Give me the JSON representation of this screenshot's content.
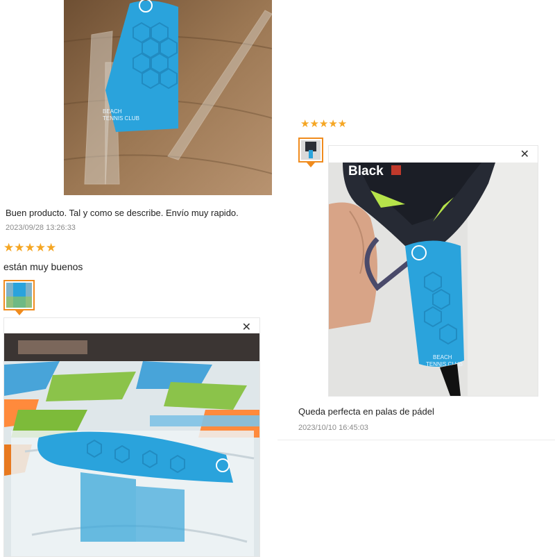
{
  "reviews": [
    {
      "text": "Buen producto. Tal y como se describe. Envío muy rapido.",
      "date": "2023/09/28 13:26:33"
    },
    {
      "stars": "★★★★★",
      "text": "están muy buenos",
      "close_label": "✕"
    },
    {
      "stars": "★★★★★",
      "text": "Queda perfecta en palas de pádel",
      "date": "2023/10/10 16:45:03",
      "close_label": "✕"
    }
  ],
  "photo_print": {
    "grip_logo": "e",
    "grip_text_line1": "BEACH",
    "grip_text_line2": "TENNIS CLUB",
    "racket_brand": "Black"
  },
  "colors": {
    "star": "#f5a623",
    "thumb_border": "#f08b1d",
    "grip_blue": "#2aa3dc"
  }
}
